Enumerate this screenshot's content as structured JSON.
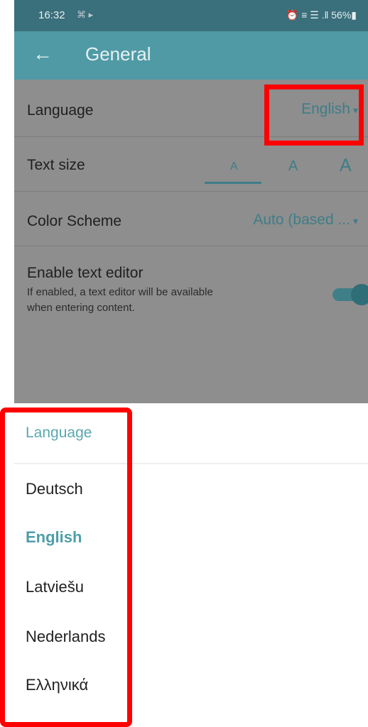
{
  "status_bar": {
    "time": "16:32",
    "left_icons": "⌘ ▸",
    "right_icons": "⏰ ≡ ☰ .‖ 56%▮"
  },
  "app_bar": {
    "title": "General",
    "back_icon": "←"
  },
  "settings": {
    "language_label": "Language",
    "language_value": "English",
    "text_size_label": "Text size",
    "text_size_options": [
      "A",
      "A",
      "A"
    ],
    "color_scheme_label": "Color Scheme",
    "color_scheme_value": "Auto (based ...",
    "text_editor_label": "Enable text editor",
    "text_editor_desc_line1": "If enabled, a text editor will be available",
    "text_editor_desc_line2": "when entering content.",
    "text_editor_enabled": true,
    "dropdown_caret": "▾"
  },
  "language_sheet": {
    "title": "Language",
    "options": [
      "Deutsch",
      "English",
      "Latviešu",
      "Nederlands",
      "Ελληνικά"
    ],
    "selected": "English"
  },
  "colors": {
    "accent": "#4f9aa5",
    "highlight": "#ff0000"
  }
}
